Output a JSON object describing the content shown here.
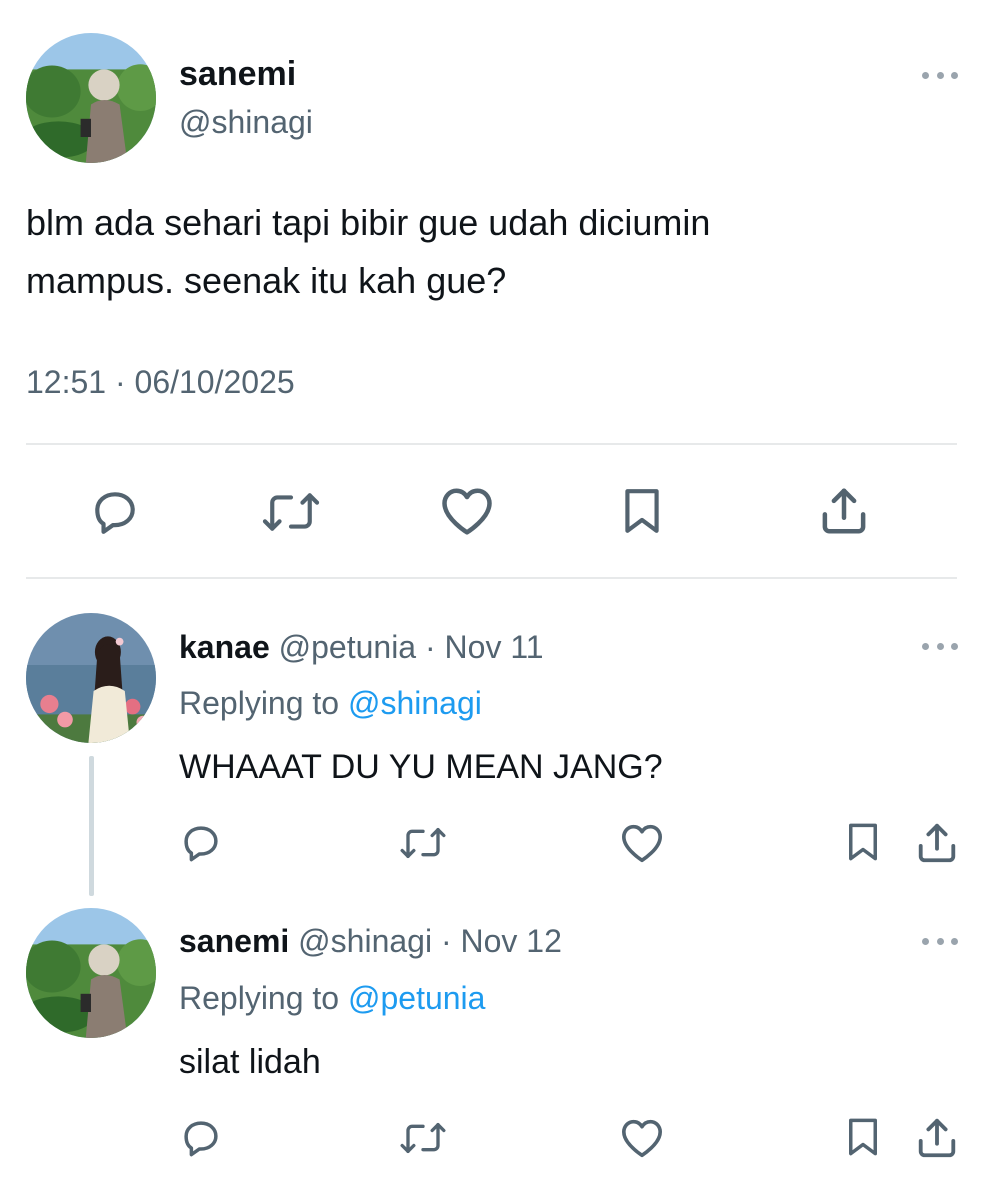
{
  "main_tweet": {
    "display_name": "sanemi",
    "handle": "@shinagi",
    "text_lines": [
      "blm ada sehari tapi bibir gue udah diciumin",
      "mampus. seenak itu kah gue?"
    ],
    "timestamp": "12:51 · 06/10/2025",
    "avatar_icon": "avatar-photo-garden",
    "actions": [
      "reply-icon",
      "retweet-icon",
      "like-icon",
      "bookmark-icon",
      "share-icon"
    ]
  },
  "replies": [
    {
      "display_name": "kanae",
      "handle": "@petunia",
      "date": "Nov 11",
      "replying_label": "Replying to",
      "replying_to": "@shinagi",
      "text": "WHAAAT DU YU MEAN JANG?",
      "avatar_icon": "avatar-photo-lake"
    },
    {
      "display_name": "sanemi",
      "handle": "@shinagi",
      "date": "Nov 12",
      "replying_label": "Replying to",
      "replying_to": "@petunia",
      "text": "silat lidah",
      "avatar_icon": "avatar-photo-garden"
    }
  ],
  "colors": {
    "text": "#0f1419",
    "secondary": "#536471",
    "link": "#1d9bf0",
    "divider": "#e7e9ea"
  }
}
